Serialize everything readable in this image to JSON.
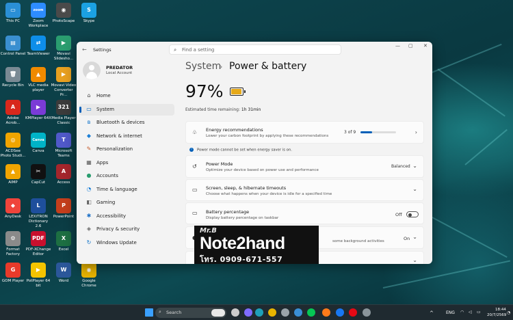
{
  "desktop": {
    "icons": [
      {
        "label": "This PC",
        "icon": "monitor-icon",
        "color": "#2a8fd6",
        "glyph": "▭"
      },
      {
        "label": "Zoom Workplace",
        "icon": "zoom-icon",
        "color": "#2d8cff",
        "glyph": "zoom"
      },
      {
        "label": "PhotoScape",
        "icon": "photoscape-icon",
        "color": "#4a4a4a",
        "glyph": "◉"
      },
      {
        "label": "Skype",
        "icon": "skype-icon",
        "color": "#1ba1e2",
        "glyph": "S"
      },
      {
        "label": "Control Panel",
        "icon": "control-panel-icon",
        "color": "#3a8fd0",
        "glyph": "▤"
      },
      {
        "label": "TeamViewer",
        "icon": "teamviewer-icon",
        "color": "#0e8ee9",
        "glyph": "⇄"
      },
      {
        "label": "Movavi Slidesho...",
        "icon": "movavi-slideshow-icon",
        "color": "#2a9d6f",
        "glyph": "▶"
      },
      {
        "label": "Recycle Bin",
        "icon": "recycle-bin-icon",
        "color": "#7a8a94",
        "glyph": "🗑"
      },
      {
        "label": "VLC media player",
        "icon": "vlc-icon",
        "color": "#f08a00",
        "glyph": "▲"
      },
      {
        "label": "Movavi Video Converter Pr...",
        "icon": "movavi-converter-icon",
        "color": "#e8a020",
        "glyph": "▶"
      },
      {
        "label": "Adobe Acrob...",
        "icon": "acrobat-icon",
        "color": "#d8281c",
        "glyph": "A"
      },
      {
        "label": "KMPlayer 64X",
        "icon": "kmplayer-icon",
        "color": "#7b3bd6",
        "glyph": "▶"
      },
      {
        "label": "Media Player Classic",
        "icon": "media-player-classic-icon",
        "color": "#3b3b3b",
        "glyph": "321"
      },
      {
        "label": "ACDSee Photo Studi...",
        "icon": "acdsee-icon",
        "color": "#f0a500",
        "glyph": "◎"
      },
      {
        "label": "Canva",
        "icon": "canva-icon",
        "color": "#00b4c8",
        "glyph": "Canva"
      },
      {
        "label": "Microsoft Teams",
        "icon": "teams-icon",
        "color": "#5059c9",
        "glyph": "T"
      },
      {
        "label": "AIMP",
        "icon": "aimp-icon",
        "color": "#f0a500",
        "glyph": "▲"
      },
      {
        "label": "CapCut",
        "icon": "capcut-icon",
        "color": "#111111",
        "glyph": "✂"
      },
      {
        "label": "Access",
        "icon": "access-icon",
        "color": "#a4262c",
        "glyph": "A"
      },
      {
        "label": "AnyDesk",
        "icon": "anydesk-icon",
        "color": "#ef443b",
        "glyph": "◆"
      },
      {
        "label": "LEXiTRON Dictionary 2.6",
        "icon": "lexitron-icon",
        "color": "#1e4f9c",
        "glyph": "L"
      },
      {
        "label": "PowerPoint",
        "icon": "powerpoint-icon",
        "color": "#c43e1c",
        "glyph": "P"
      },
      {
        "label": "Format Factory",
        "icon": "format-factory-icon",
        "color": "#8a8a8a",
        "glyph": "⚙"
      },
      {
        "label": "PDF-XChange Editor",
        "icon": "pdf-xchange-icon",
        "color": "#c8102e",
        "glyph": "PDF"
      },
      {
        "label": "Excel",
        "icon": "excel-icon",
        "color": "#1d6f42",
        "glyph": "X"
      },
      {
        "label": "GOM Player",
        "icon": "gom-player-icon",
        "color": "#e83a2a",
        "glyph": "G"
      },
      {
        "label": "PotPlayer 64 bit",
        "icon": "potplayer-icon",
        "color": "#f5c400",
        "glyph": "▶"
      },
      {
        "label": "Word",
        "icon": "word-icon",
        "color": "#2b579a",
        "glyph": "W"
      },
      {
        "label": "Google Chrome",
        "icon": "chrome-icon",
        "color": "#e8b400",
        "glyph": "◉"
      }
    ]
  },
  "settings": {
    "app_name": "Settings",
    "search_placeholder": "Find a setting",
    "user": {
      "name": "PREDATOR",
      "account_type": "Local Account"
    },
    "nav": [
      {
        "label": "Home",
        "icon": "home-icon",
        "glyph": "⌂",
        "color": "#444"
      },
      {
        "label": "System",
        "icon": "system-icon",
        "glyph": "▭",
        "color": "#0067c0"
      },
      {
        "label": "Bluetooth & devices",
        "icon": "bluetooth-icon",
        "glyph": "ʙ",
        "color": "#0a70c8"
      },
      {
        "label": "Network & internet",
        "icon": "network-icon",
        "glyph": "◆",
        "color": "#1b7fd6"
      },
      {
        "label": "Personalization",
        "icon": "personalization-icon",
        "glyph": "✎",
        "color": "#c45a2a"
      },
      {
        "label": "Apps",
        "icon": "apps-icon",
        "glyph": "▦",
        "color": "#555"
      },
      {
        "label": "Accounts",
        "icon": "accounts-icon",
        "glyph": "●",
        "color": "#2a9d6f"
      },
      {
        "label": "Time & language",
        "icon": "time-language-icon",
        "glyph": "◔",
        "color": "#1b7fd6"
      },
      {
        "label": "Gaming",
        "icon": "gaming-icon",
        "glyph": "◧",
        "color": "#666"
      },
      {
        "label": "Accessibility",
        "icon": "accessibility-icon",
        "glyph": "✱",
        "color": "#1b6fc6"
      },
      {
        "label": "Privacy & security",
        "icon": "privacy-shield-icon",
        "glyph": "◈",
        "color": "#666"
      },
      {
        "label": "Windows Update",
        "icon": "windows-update-icon",
        "glyph": "↻",
        "color": "#0a70c8"
      }
    ],
    "selected_nav": "System",
    "breadcrumb": {
      "parent": "System",
      "separator": "›",
      "current": "Power & battery"
    },
    "battery": {
      "percent_label": "97%",
      "level": 0.97,
      "fill_color": "#e6a919"
    },
    "estimate": {
      "label": "Estimated time remaining:",
      "value": "1h 31min"
    },
    "energy": {
      "title": "Energy recommendations",
      "subtitle": "Lower your carbon footprint by applying these recommendations",
      "count": "3 of 9",
      "progress": 0.3333
    },
    "info_message": "Power mode cannot be set when energy saver is on.",
    "power_mode": {
      "title": "Power Mode",
      "subtitle": "Optimize your device based on power use and performance",
      "value": "Balanced"
    },
    "screen_sleep": {
      "title": "Screen, sleep, & hibernate timeouts",
      "subtitle": "Choose what happens when your device is idle for a specified time"
    },
    "battery_pct": {
      "title": "Battery percentage",
      "subtitle": "Display battery percentage on taskbar",
      "value": "Off"
    },
    "energy_saver": {
      "subtitle_partial": "some background activities",
      "value": "On"
    }
  },
  "watermark": {
    "line1": "Mr.B",
    "line2": "Note2hand",
    "line3": "โทร. 0909-671-557"
  },
  "taskbar": {
    "search_label": "Search",
    "apps": [
      {
        "icon": "start-icon",
        "color": "#3aa0ff"
      },
      {
        "icon": "task-view-icon",
        "color": "#cccccc"
      },
      {
        "icon": "copilot-icon",
        "color": "#7f6bff"
      },
      {
        "icon": "edge-icon",
        "color": "#1fa0b8"
      },
      {
        "icon": "chrome-icon",
        "color": "#e8b400"
      },
      {
        "icon": "camera-icon",
        "color": "#9aa4aa"
      },
      {
        "icon": "photos-icon",
        "color": "#3a8fd6"
      },
      {
        "icon": "line-icon",
        "color": "#06c755"
      },
      {
        "icon": "firefox-icon",
        "color": "#ff7a1a"
      },
      {
        "icon": "facebook-icon",
        "color": "#1877f2"
      },
      {
        "icon": "netflix-icon",
        "color": "#e50914"
      },
      {
        "icon": "settings-gear-icon",
        "color": "#8a959b"
      }
    ],
    "language": "ENG",
    "time": "18:44",
    "date": "20/7/2569"
  }
}
